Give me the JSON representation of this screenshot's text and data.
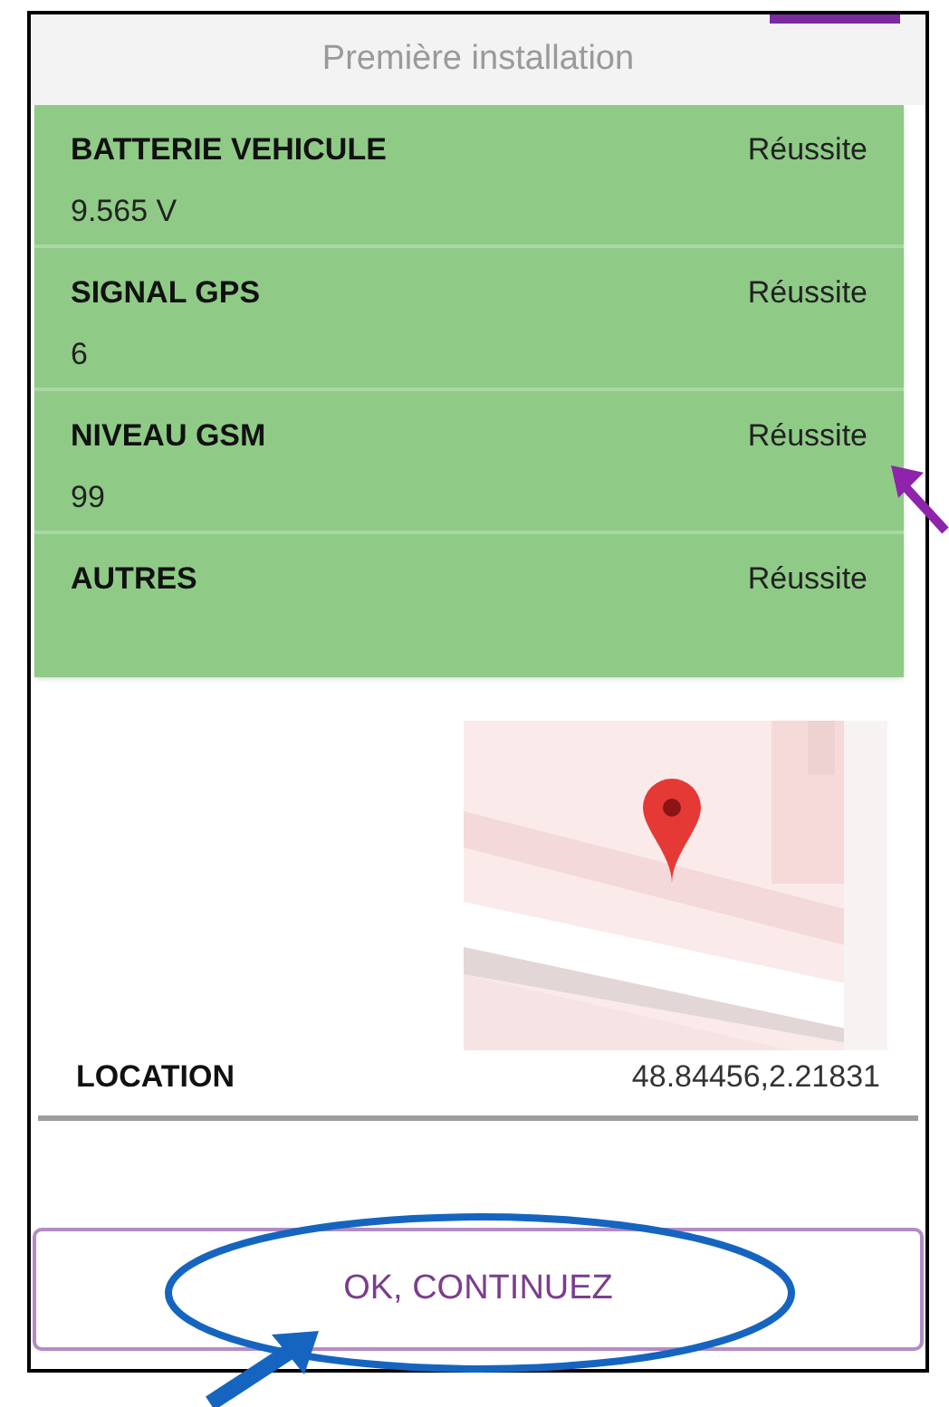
{
  "header": {
    "title": "Première installation"
  },
  "checks": [
    {
      "label": "BATTERIE VEHICULE",
      "value": "9.565 V",
      "result": "Réussite"
    },
    {
      "label": "SIGNAL GPS",
      "value": "6",
      "result": "Réussite"
    },
    {
      "label": "NIVEAU GSM",
      "value": "99",
      "result": "Réussite"
    },
    {
      "label": "AUTRES",
      "result": "Réussite"
    }
  ],
  "location": {
    "label": "LOCATION",
    "value": "48.84456,2.21831"
  },
  "button": {
    "label": "OK, CONTINUEZ"
  }
}
